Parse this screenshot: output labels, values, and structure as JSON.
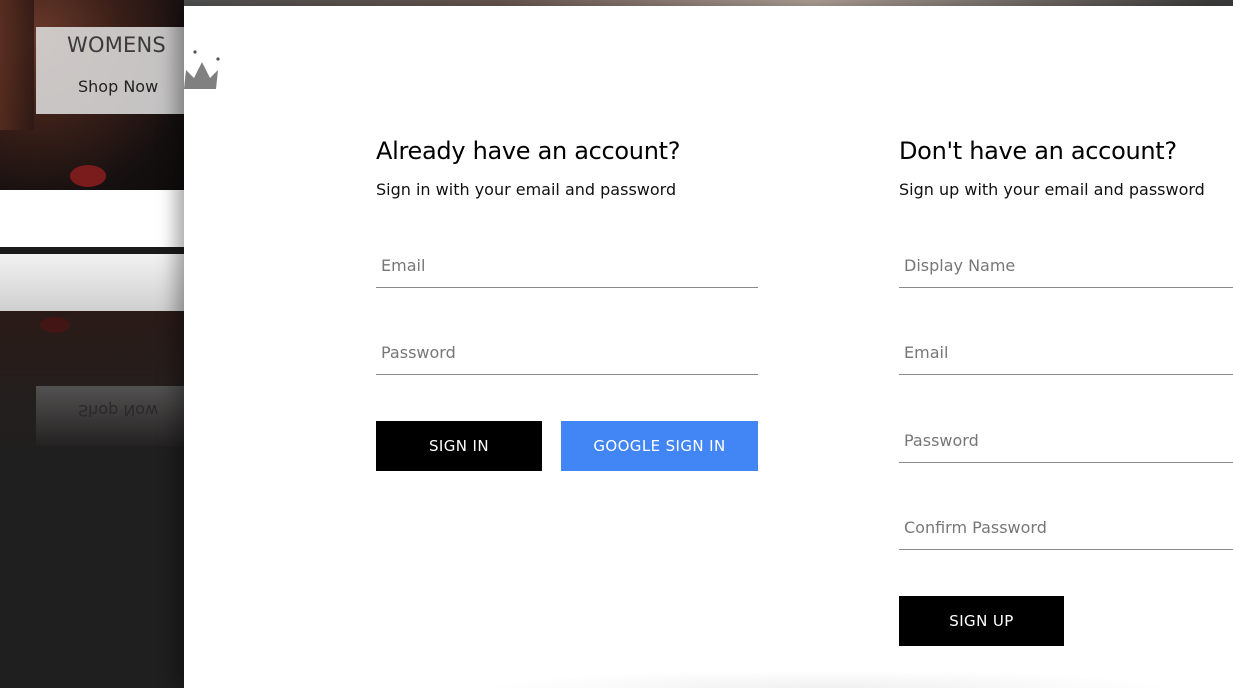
{
  "background": {
    "category_card": {
      "title": "WOMENS",
      "subtitle": "Shop Now"
    },
    "reflection_text": "Shop Now"
  },
  "logo": {
    "icon": "crown-icon"
  },
  "sign_in": {
    "title": "Already have an account?",
    "subtitle": "Sign in with your email and password",
    "email_placeholder": "Email",
    "password_placeholder": "Password",
    "sign_in_label": "SIGN IN",
    "google_label": "GOOGLE SIGN IN"
  },
  "sign_up": {
    "title": "Don't have an account?",
    "subtitle": "Sign up with your email and password",
    "display_name_placeholder": "Display Name",
    "email_placeholder": "Email",
    "password_placeholder": "Password",
    "confirm_password_placeholder": "Confirm Password",
    "sign_up_label": "SIGN UP"
  },
  "colors": {
    "primary_button": "#000000",
    "google_button": "#4285f4",
    "sheet": "#ffffff"
  }
}
